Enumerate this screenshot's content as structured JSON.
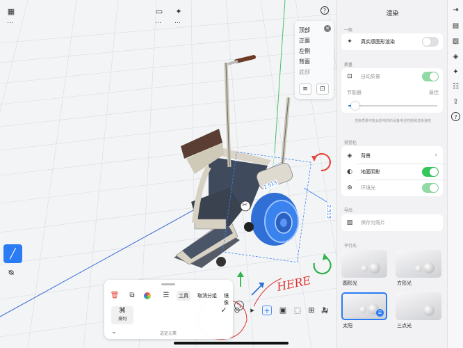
{
  "toolbar_top": {
    "grid_icon": "grid-icon",
    "more_icon": "more-icon",
    "ellipsis": "…",
    "presentation_icon": "presentation-icon",
    "sparkle_icon": "sparkle-icon",
    "help_icon": "help-icon"
  },
  "view_menu": {
    "items": [
      "顶部",
      "正面",
      "左侧",
      "背面",
      "底部"
    ],
    "disabled_item": "底部"
  },
  "dimensions": {
    "d1": "2.513",
    "d2": "2.513"
  },
  "annotation": {
    "text": "HERE"
  },
  "tool_card": {
    "tabs": [
      "工具",
      "取消分组",
      "镜像"
    ],
    "selected_tab": "工具",
    "arrange_label": "排列",
    "hint": "选定元素"
  },
  "panel": {
    "title": "渲染",
    "sections": {
      "general": "一般",
      "quality": "质量",
      "visualization": "视觉化",
      "export": "导出",
      "parallel_light": "平行光"
    },
    "photoreal": {
      "label": "真实感图形渲染",
      "on": false
    },
    "auto_quality": {
      "label": "自动质量",
      "on": true
    },
    "saver": {
      "label": "节能器",
      "right_label": "最佳",
      "value": 0.08
    },
    "quality_note": "渲染质量可能会影响你的设备电池性能和渲染速度",
    "background": {
      "label": "背景"
    },
    "ground_shadow": {
      "label": "地面阴影",
      "on": true
    },
    "ambient": {
      "label": "环境光",
      "on": true
    },
    "save_image": {
      "label": "保存为照片"
    },
    "lights": [
      {
        "label": "圆形光",
        "selected": false
      },
      {
        "label": "方形光",
        "selected": false
      },
      {
        "label": "太阳",
        "selected": true
      },
      {
        "label": "三点光",
        "selected": false
      }
    ]
  },
  "colors": {
    "accent": "#2b7cf4",
    "toggle_on": "#34c759",
    "rotate_red": "#e8453c",
    "rotate_green": "#2fb34a",
    "annotation_red": "#e0322f"
  }
}
